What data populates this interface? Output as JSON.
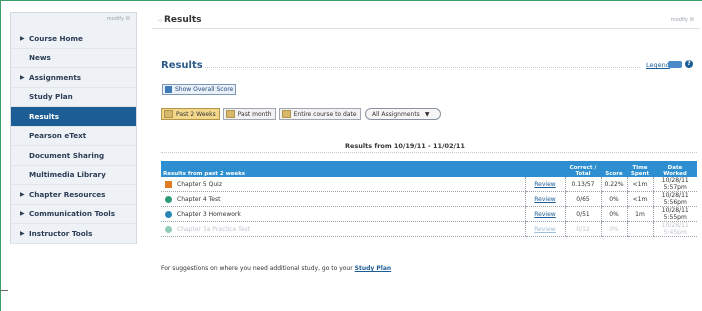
{
  "sidebar": {
    "control": "modify ☒",
    "items": [
      {
        "label": "Course Home",
        "arrow": true
      },
      {
        "label": "News",
        "arrow": false
      },
      {
        "label": "Assignments",
        "arrow": true
      },
      {
        "label": "Study Plan",
        "arrow": false
      },
      {
        "label": "Results",
        "arrow": false,
        "active": true
      },
      {
        "label": "Pearson eText",
        "arrow": false
      },
      {
        "label": "Document Sharing",
        "arrow": false
      },
      {
        "label": "Multimedia Library",
        "arrow": false
      },
      {
        "label": "Chapter Resources",
        "arrow": true
      },
      {
        "label": "Communication Tools",
        "arrow": true
      },
      {
        "label": "Instructor Tools",
        "arrow": true
      }
    ]
  },
  "header": {
    "prefix": "››",
    "title": "Results",
    "control": "modify ☒"
  },
  "results": {
    "title": "Results",
    "legend_label": "Legend",
    "show_overall_label": "Show Overall Score",
    "filters": [
      "Past 2 Weeks",
      "Past month",
      "Entire course to date"
    ],
    "assignments_select": "All Assignments",
    "range_text": "Results from 10/19/11 - 11/02/11",
    "table": {
      "headers": [
        "Results from past 2 weeks",
        "",
        "Correct / Total",
        "Score",
        "Time Spent",
        "Date Worked"
      ],
      "rows": [
        {
          "icon": "quiz",
          "name": "Chapter 5 Quiz",
          "link": "Review",
          "correct": "0.13/57",
          "score": "0.22%",
          "time": "<1m",
          "date": "10/28/11 5:57pm",
          "faded": false
        },
        {
          "icon": "test",
          "name": "Chapter 4 Test",
          "link": "Review",
          "correct": "0/65",
          "score": "0%",
          "time": "<1m",
          "date": "10/28/11 5:56pm",
          "faded": false
        },
        {
          "icon": "homework",
          "name": "Chapter 3 Homework",
          "link": "Review",
          "correct": "0/51",
          "score": "0%",
          "time": "1m",
          "date": "10/28/11 5:55pm",
          "faded": false
        },
        {
          "icon": "test",
          "name": "Chapter 3a Practice Test",
          "link": "Review",
          "correct": "0/12",
          "score": "0%",
          "time": "",
          "date": "10/28/11 5:45pm",
          "faded": true
        }
      ]
    },
    "footer_text": "For suggestions on where you need additional study, go to your",
    "footer_link": "Study Plan"
  }
}
